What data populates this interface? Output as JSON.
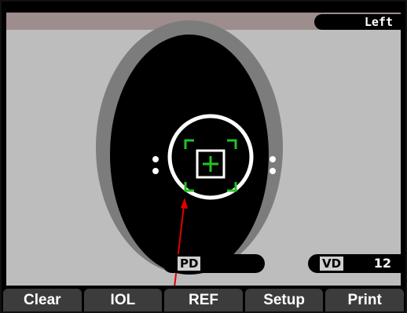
{
  "header": {
    "eye_label": "Left"
  },
  "measurements": {
    "pd_label": "PD",
    "vd_label": "VD",
    "vd_value": "12"
  },
  "menu": {
    "buttons": [
      "Clear",
      "IOL",
      "REF",
      "Setup",
      "Print"
    ]
  },
  "colors": {
    "alignment_mark": "#23c223",
    "pointer_arrow": "#e00000",
    "background": "#bdbdbd"
  }
}
